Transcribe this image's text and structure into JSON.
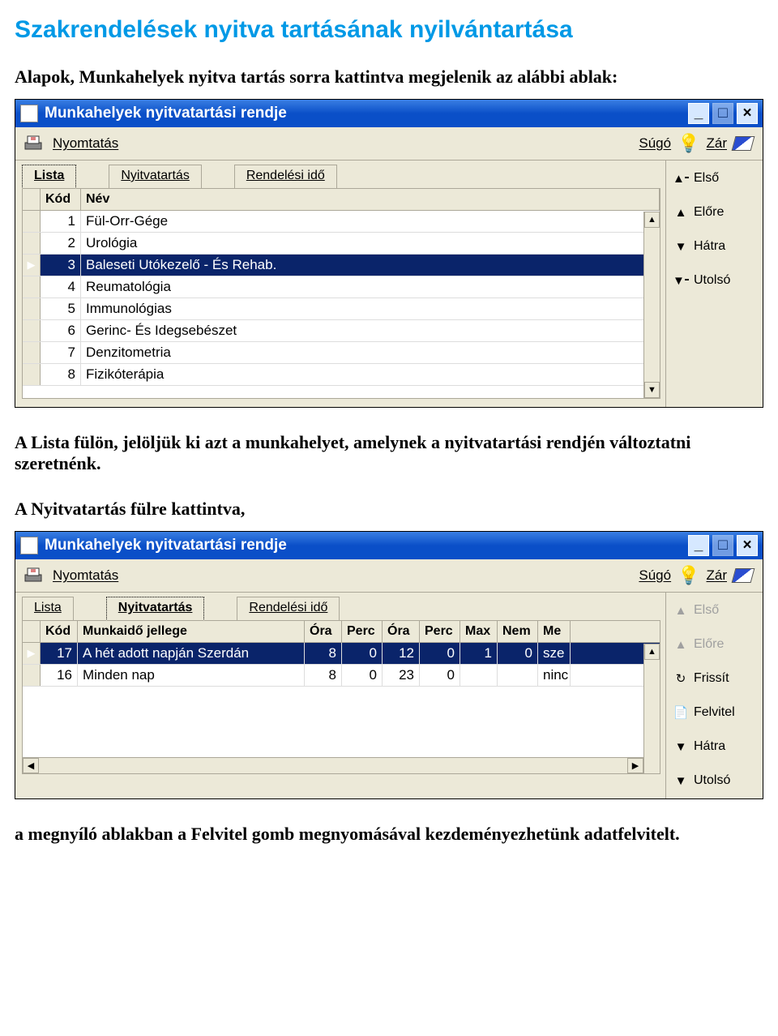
{
  "page": {
    "title": "Szakrendelések nyitva tartásának nyilvántartása",
    "intro": "Alapok, Munkahelyek nyitva tartás sorra kattintva megjelenik az alábbi ablak:",
    "mid1": "A Lista fülön, jelöljük ki azt a munkahelyet, amelynek a nyitvatartási rendjén változtatni szeretnénk.",
    "mid2": "A Nyitvatartás fülre kattintva,",
    "footer": "a megnyíló ablakban a Felvitel gomb megnyomásával kezdeményezhetünk adatfelvitelt."
  },
  "window1": {
    "title": "Munkahelyek nyitvatartási rendje",
    "menu_print": "Nyomtatás",
    "menu_help": "Súgó",
    "menu_close": "Zár",
    "tabs": {
      "lista": "Lista",
      "nyitva": "Nyitvatartás",
      "rendel": "Rendelési idő"
    },
    "col_kod": "Kód",
    "col_nev": "Név",
    "rows": [
      {
        "kod": "1",
        "nev": "Fül-Orr-Gége"
      },
      {
        "kod": "2",
        "nev": "Urológia"
      },
      {
        "kod": "3",
        "nev": "Baleseti Utókezelő - És Rehab."
      },
      {
        "kod": "4",
        "nev": "Reumatológia"
      },
      {
        "kod": "5",
        "nev": "Immunológias"
      },
      {
        "kod": "6",
        "nev": "Gerinc- És Idegsebészet"
      },
      {
        "kod": "7",
        "nev": "Denzitometria"
      },
      {
        "kod": "8",
        "nev": "Fizikóterápia"
      }
    ],
    "nav": {
      "first": "Első",
      "prev": "Előre",
      "next": "Hátra",
      "last": "Utolsó"
    }
  },
  "window2": {
    "title": "Munkahelyek nyitvatartási rendje",
    "menu_print": "Nyomtatás",
    "menu_help": "Súgó",
    "menu_close": "Zár",
    "tabs": {
      "lista": "Lista",
      "nyitva": "Nyitvatartás",
      "rendel": "Rendelési idő"
    },
    "cols": {
      "kod": "Kód",
      "jelleg": "Munkaidő jellege",
      "ora1": "Óra",
      "perc1": "Perc",
      "ora2": "Óra",
      "perc2": "Perc",
      "max": "Max",
      "nem": "Nem",
      "me": "Me"
    },
    "rows": [
      {
        "kod": "17",
        "jelleg": "A hét adott napján Szerdán",
        "o1": "8",
        "p1": "0",
        "o2": "12",
        "p2": "0",
        "max": "1",
        "nem": "0",
        "me": "sze"
      },
      {
        "kod": "16",
        "jelleg": "Minden nap",
        "o1": "8",
        "p1": "0",
        "o2": "23",
        "p2": "0",
        "max": "",
        "nem": "",
        "me": "ninc"
      }
    ],
    "nav": {
      "first": "Első",
      "prev": "Előre",
      "refresh": "Frissít",
      "new": "Felvitel",
      "next": "Hátra",
      "last": "Utolsó"
    }
  }
}
